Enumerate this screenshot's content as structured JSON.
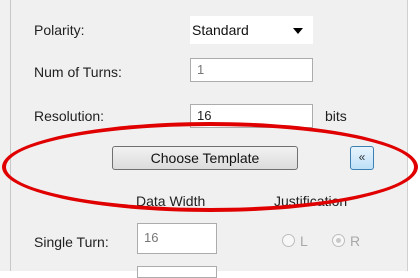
{
  "form": {
    "polarity_label": "Polarity:",
    "polarity_value": "Standard",
    "turns_label": "Num of Turns:",
    "turns_value": "1",
    "resolution_label": "Resolution:",
    "resolution_value": "16",
    "resolution_unit": "bits",
    "choose_template_label": "Choose Template",
    "collapse_label": "«",
    "data_width_header": "Data Width",
    "justification_header": "Justification",
    "single_turn_label": "Single Turn:",
    "single_turn_value": "16",
    "radio_l_label": "L",
    "radio_r_label": "R"
  },
  "colors": {
    "highlight": "#e00000"
  }
}
